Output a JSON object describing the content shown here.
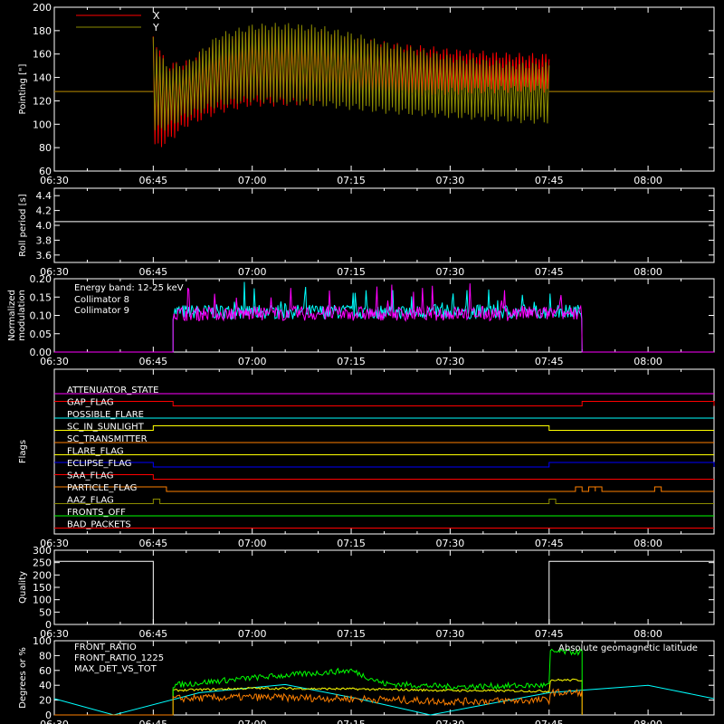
{
  "x_ticks": [
    "06:30",
    "06:45",
    "07:00",
    "07:15",
    "07:30",
    "07:45",
    "08:00"
  ],
  "chart_data": [
    {
      "type": "line",
      "ylabel": "Pointing [\"]",
      "ylim": [
        60,
        200
      ],
      "yticks": [
        60,
        80,
        100,
        120,
        140,
        160,
        180,
        200
      ],
      "xlim": [
        "06:30",
        "08:10"
      ],
      "legend": [
        {
          "name": "X",
          "color": "#ff0000"
        },
        {
          "name": "Y",
          "color": "#8c8c00"
        }
      ],
      "series": [
        {
          "name": "X",
          "color": "#ff0000",
          "baseline": 128,
          "start": "06:45",
          "end": "07:45",
          "x": [
            "06:45",
            "06:47",
            "06:50",
            "06:55",
            "07:00",
            "07:05",
            "07:10",
            "07:15",
            "07:20",
            "07:30",
            "07:40",
            "07:45"
          ],
          "upper": [
            175,
            150,
            152,
            170,
            180,
            180,
            178,
            172,
            168,
            162,
            158,
            158
          ],
          "lower": [
            80,
            85,
            100,
            112,
            118,
            118,
            120,
            122,
            125,
            128,
            130,
            130
          ]
        },
        {
          "name": "Y",
          "color": "#8c8c00",
          "baseline": 128,
          "start": "06:45",
          "end": "07:45",
          "x": [
            "06:45",
            "06:47",
            "06:50",
            "06:55",
            "07:00",
            "07:05",
            "07:10",
            "07:15",
            "07:20",
            "07:30",
            "07:40",
            "07:45"
          ],
          "upper": [
            172,
            148,
            150,
            175,
            183,
            184,
            182,
            176,
            168,
            156,
            150,
            150
          ],
          "lower": [
            95,
            98,
            108,
            118,
            122,
            120,
            118,
            115,
            112,
            108,
            104,
            103
          ]
        }
      ]
    },
    {
      "type": "line",
      "ylabel": "Roll period [s]",
      "ylim": [
        3.5,
        4.5
      ],
      "yticks": [
        3.6,
        3.8,
        4.0,
        4.2,
        4.4
      ],
      "series": [
        {
          "name": "",
          "color": "#ffffff",
          "x": [
            "06:30",
            "08:10"
          ],
          "y": [
            4.05,
            4.05
          ]
        }
      ]
    },
    {
      "type": "line",
      "ylabel": "Normalized modulation",
      "ylim": [
        0,
        0.2
      ],
      "yticks": [
        0.0,
        0.05,
        0.1,
        0.15,
        0.2
      ],
      "annotation": "Energy band: 12-25 keV",
      "legend": [
        {
          "name": "Collimator 8",
          "color": "#00ffff"
        },
        {
          "name": "Collimator 9",
          "color": "#ff00ff"
        }
      ],
      "series": [
        {
          "name": "Collimator 8",
          "color": "#00ffff",
          "start": "06:48",
          "end": "07:50",
          "mean": 0.11,
          "spread": 0.02
        },
        {
          "name": "Collimator 9",
          "color": "#ff00ff",
          "start": "06:48",
          "end": "07:50",
          "mean": 0.105,
          "spread": 0.02
        }
      ]
    },
    {
      "type": "line",
      "ylabel": "Flags",
      "flags": [
        {
          "name": "ATTENUATOR_STATE",
          "color": "#ff00ff",
          "high": []
        },
        {
          "name": "GAP_FLAG",
          "color": "#ff0000",
          "high": [
            [
              "06:30",
              "06:48"
            ],
            [
              "07:50",
              "08:10"
            ]
          ]
        },
        {
          "name": "POSSIBLE_FLARE",
          "color": "#00ffff",
          "high": []
        },
        {
          "name": "SC_IN_SUNLIGHT",
          "color": "#ffff00",
          "high": [
            [
              "06:45",
              "07:45"
            ]
          ]
        },
        {
          "name": "SC_TRANSMITTER",
          "color": "#ff8000",
          "high": []
        },
        {
          "name": "FLARE_FLAG",
          "color": "#ffff00",
          "high": []
        },
        {
          "name": "ECLIPSE_FLAG",
          "color": "#0000ff",
          "high": [
            [
              "06:30",
              "06:45"
            ],
            [
              "07:45",
              "08:10"
            ]
          ]
        },
        {
          "name": "SAA_FLAG",
          "color": "#ff0000",
          "high": [
            [
              "06:30",
              "06:45"
            ]
          ]
        },
        {
          "name": "PARTICLE_FLAG",
          "color": "#ff8000",
          "high": [
            [
              "06:30",
              "06:47"
            ],
            [
              "07:49",
              "07:50"
            ],
            [
              "07:51",
              "07:52"
            ],
            [
              "07:52",
              "07:53"
            ],
            [
              "08:01",
              "08:02"
            ]
          ]
        },
        {
          "name": "AAZ_FLAG",
          "color": "#8c8c00",
          "high": [
            [
              "06:45",
              "06:46"
            ],
            [
              "07:45",
              "07:46"
            ]
          ]
        },
        {
          "name": "FRONTS_OFF",
          "color": "#00ff00",
          "high": []
        },
        {
          "name": "BAD_PACKETS",
          "color": "#ff0000",
          "high": []
        }
      ]
    },
    {
      "type": "line",
      "ylabel": "Quality",
      "ylim": [
        0,
        300
      ],
      "yticks": [
        0,
        50,
        100,
        150,
        200,
        250,
        300
      ],
      "series": [
        {
          "name": "",
          "color": "#ffffff",
          "x": [
            "06:30",
            "06:45",
            "06:45",
            "07:45",
            "07:45",
            "08:10"
          ],
          "y": [
            255,
            255,
            0,
            0,
            255,
            255
          ]
        }
      ]
    },
    {
      "type": "line",
      "ylabel": "Degrees or %",
      "ylim": [
        0,
        100
      ],
      "yticks": [
        0,
        20,
        40,
        60,
        80,
        100
      ],
      "annotation": "Absolute geomagnetic latitude",
      "annotation_color": "#00ffff",
      "legend": [
        {
          "name": "FRONT_RATIO",
          "color": "#ffff00"
        },
        {
          "name": "FRONT_RATIO_1225",
          "color": "#00ff00"
        },
        {
          "name": "MAX_DET_VS_TOT",
          "color": "#ff8000"
        }
      ],
      "series": [
        {
          "name": "Absolute geomagnetic latitude",
          "color": "#00ffff",
          "x": [
            "06:30",
            "06:39",
            "06:52",
            "07:05",
            "07:16",
            "07:27",
            "07:45",
            "08:00",
            "08:10"
          ],
          "y": [
            22,
            0,
            30,
            41,
            22,
            0,
            30,
            40,
            22
          ]
        },
        {
          "name": "FRONT_RATIO",
          "color": "#ffff00",
          "x": [
            "06:48",
            "07:00",
            "07:15",
            "07:30",
            "07:45",
            "07:45",
            "07:50"
          ],
          "y": [
            33,
            36,
            35,
            33,
            32,
            47,
            47
          ],
          "start": "06:48",
          "end": "07:50"
        },
        {
          "name": "FRONT_RATIO_1225",
          "color": "#00ff00",
          "x": [
            "06:48",
            "07:00",
            "07:15",
            "07:20",
            "07:30",
            "07:45",
            "07:45",
            "07:50"
          ],
          "y": [
            40,
            50,
            60,
            42,
            38,
            40,
            85,
            85
          ],
          "start": "06:48",
          "end": "07:50"
        },
        {
          "name": "MAX_DET_VS_TOT",
          "color": "#ff8000",
          "x": [
            "06:48",
            "07:00",
            "07:15",
            "07:30",
            "07:45",
            "07:45",
            "07:50"
          ],
          "y": [
            22,
            24,
            22,
            18,
            20,
            30,
            30
          ],
          "start": "06:48",
          "end": "07:50"
        }
      ]
    }
  ]
}
